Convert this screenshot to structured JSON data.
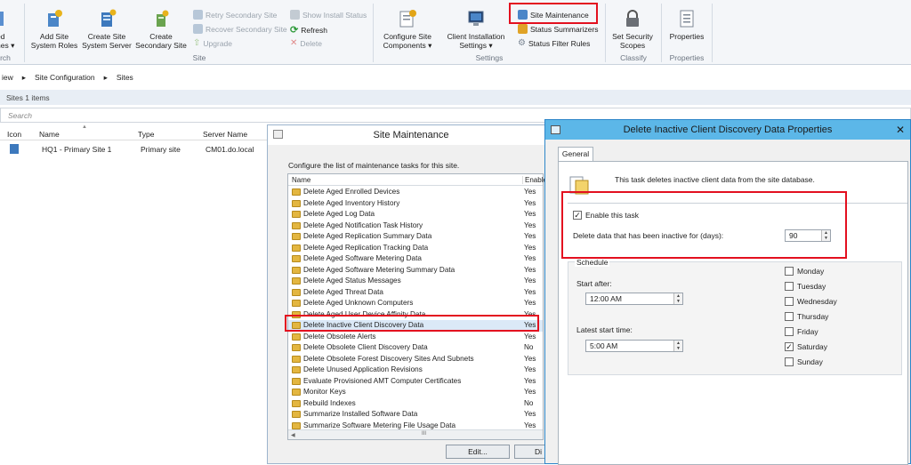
{
  "ribbon": {
    "left_partial": [
      "ed",
      "nes"
    ],
    "left_group_partial": "rch",
    "add_site_system_roles": "Add Site System Roles",
    "create_site_system_server": "Create Site System Server",
    "create_secondary_site": "Create Secondary Site",
    "retry_secondary_site": "Retry Secondary Site",
    "recover_secondary_site": "Recover Secondary Site",
    "upgrade": "Upgrade",
    "show_install_status": "Show Install Status",
    "refresh": "Refresh",
    "delete": "Delete",
    "site_group": "Site",
    "configure_site_components": "Configure Site Components",
    "client_installation_settings": "Client Installation Settings",
    "site_maintenance": "Site Maintenance",
    "status_summarizers": "Status Summarizers",
    "status_filter_rules": "Status Filter Rules",
    "settings_group": "Settings",
    "set_security_scopes": "Set Security Scopes",
    "classify_group": "Classify",
    "properties": "Properties",
    "properties_group": "Properties"
  },
  "breadcrumb": [
    "iew",
    "Site Configuration",
    "Sites"
  ],
  "list": {
    "header": "Sites 1 items",
    "search_placeholder": "Search",
    "columns": [
      "Icon",
      "Name",
      "Type",
      "Server Name"
    ],
    "row": {
      "name": "HQ1 - Primary Site 1",
      "type": "Primary site",
      "server": "CM01.do.local"
    }
  },
  "site_maintenance": {
    "title": "Site Maintenance",
    "description": "Configure the list of maintenance tasks for this site.",
    "col_name": "Name",
    "col_enabled": "Enable",
    "tasks": [
      {
        "name": "Delete Aged Enrolled Devices",
        "enabled": "Yes"
      },
      {
        "name": "Delete Aged Inventory History",
        "enabled": "Yes"
      },
      {
        "name": "Delete Aged Log Data",
        "enabled": "Yes"
      },
      {
        "name": "Delete Aged Notification Task History",
        "enabled": "Yes"
      },
      {
        "name": "Delete Aged Replication Summary Data",
        "enabled": "Yes"
      },
      {
        "name": "Delete Aged Replication Tracking Data",
        "enabled": "Yes"
      },
      {
        "name": "Delete Aged Software Metering Data",
        "enabled": "Yes"
      },
      {
        "name": "Delete Aged Software Metering Summary Data",
        "enabled": "Yes"
      },
      {
        "name": "Delete Aged Status Messages",
        "enabled": "Yes"
      },
      {
        "name": "Delete Aged Threat Data",
        "enabled": "Yes"
      },
      {
        "name": "Delete Aged Unknown Computers",
        "enabled": "Yes"
      },
      {
        "name": "Delete Aged User Device Affinity Data",
        "enabled": "Yes"
      },
      {
        "name": "Delete Inactive Client Discovery Data",
        "enabled": "Yes"
      },
      {
        "name": "Delete Obsolete Alerts",
        "enabled": "Yes"
      },
      {
        "name": "Delete Obsolete Client Discovery Data",
        "enabled": "No"
      },
      {
        "name": "Delete Obsolete Forest Discovery Sites And Subnets",
        "enabled": "Yes"
      },
      {
        "name": "Delete Unused Application Revisions",
        "enabled": "Yes"
      },
      {
        "name": "Evaluate Provisioned AMT Computer Certificates",
        "enabled": "Yes"
      },
      {
        "name": "Monitor Keys",
        "enabled": "Yes"
      },
      {
        "name": "Rebuild Indexes",
        "enabled": "No"
      },
      {
        "name": "Summarize Installed Software Data",
        "enabled": "Yes"
      },
      {
        "name": "Summarize Software Metering File Usage Data",
        "enabled": "Yes"
      }
    ],
    "edit_button": "Edit...",
    "disable_button_partial": "Di"
  },
  "properties_dialog": {
    "title": "Delete Inactive Client Discovery Data Properties",
    "tab": "General",
    "description": "This task deletes inactive client data from the site database.",
    "enable_label": "Enable this task",
    "inactive_label": "Delete data that has been inactive for (days):",
    "inactive_days": "90",
    "schedule_label": "Schedule",
    "start_after_label": "Start after:",
    "start_after": "12:00 AM",
    "latest_start_label": "Latest start time:",
    "latest_start": "5:00 AM",
    "days": [
      {
        "name": "Monday",
        "checked": false
      },
      {
        "name": "Tuesday",
        "checked": false
      },
      {
        "name": "Wednesday",
        "checked": false
      },
      {
        "name": "Thursday",
        "checked": false
      },
      {
        "name": "Friday",
        "checked": false
      },
      {
        "name": "Saturday",
        "checked": true
      },
      {
        "name": "Sunday",
        "checked": false
      }
    ]
  },
  "colors": {
    "highlight": "#e3101f",
    "dialog_title": "#5cb7e8"
  }
}
